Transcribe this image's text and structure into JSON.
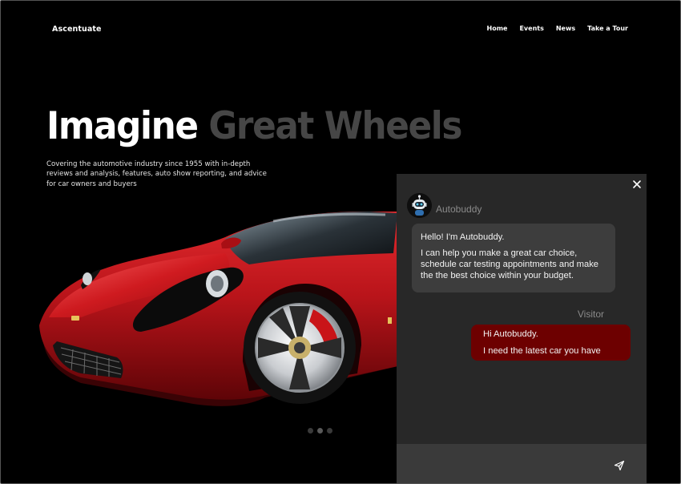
{
  "brand": "Ascentuate",
  "nav": {
    "home": "Home",
    "events": "Events",
    "news": "News",
    "tour": "Take a Tour"
  },
  "hero": {
    "headline_white": "Imagine",
    "headline_gray": "Great Wheels",
    "subtitle": "Covering the automotive industry since 1955 with in-depth reviews and analysis, features, auto show reporting, and advice for car owners and buyers"
  },
  "carousel": {
    "slide_count": 3,
    "active_index": 1
  },
  "chat": {
    "bot_name": "Autobuddy",
    "bot_message_1": "Hello! I'm Autobuddy.",
    "bot_message_2": "I can help you make a great car choice, schedule car testing appointments and make the the best choice within your budget.",
    "visitor_name": "Visitor",
    "visitor_message_1": "Hi Autobuddy.",
    "visitor_message_2": "I need the latest car you have",
    "input_value": "",
    "input_placeholder": ""
  },
  "icons": {
    "close": "close-icon",
    "send": "send-icon",
    "avatar": "robot-avatar-icon"
  },
  "colors": {
    "background": "#000000",
    "panel": "#282828",
    "bot_bubble": "#3d3d3d",
    "visitor_bubble": "#6d0000",
    "accent_red": "#b50f12"
  }
}
